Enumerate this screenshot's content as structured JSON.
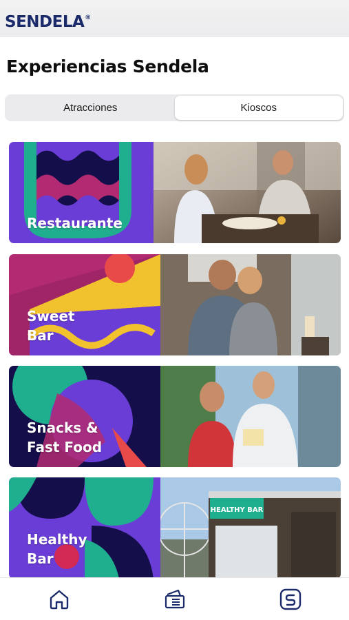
{
  "header": {
    "logo_text": "SENDELA",
    "logo_mark": "®"
  },
  "page": {
    "title": "Experiencias Sendela"
  },
  "segments": [
    {
      "label": "Atracciones",
      "active": false
    },
    {
      "label": "Kioscos",
      "active": true
    }
  ],
  "cards": [
    {
      "label": "Restaurante",
      "photo": "couple-dining-photo"
    },
    {
      "label": "Sweet\nBar",
      "photo": "couple-sweet-bar-photo"
    },
    {
      "label": "Snacks &\nFast Food",
      "photo": "couple-snacks-photo"
    },
    {
      "label": "Healthy\nBar",
      "photo": "healthy-bar-kiosk-photo",
      "sign_text": "HEALTHY BAR"
    }
  ],
  "tabbar": {
    "items": [
      {
        "icon": "home-icon"
      },
      {
        "icon": "tickets-icon"
      },
      {
        "icon": "sendela-app-icon"
      }
    ]
  },
  "colors": {
    "brand": "#1b2a6b",
    "purple": "#6a3ed6",
    "teal": "#1fae8e",
    "magenta": "#b12a72",
    "yellow": "#f2c12e",
    "navy": "#140f4a"
  }
}
